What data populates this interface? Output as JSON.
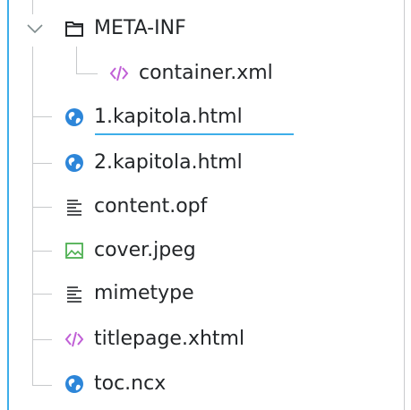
{
  "tree": {
    "items": [
      {
        "label": "META-INF",
        "icon": "folder-icon",
        "expanded": true
      },
      {
        "label": "container.xml",
        "icon": "xml-code-icon"
      },
      {
        "label": "1.kapitola.html",
        "icon": "globe-html-icon",
        "current": true
      },
      {
        "label": "2.kapitola.html",
        "icon": "globe-html-icon"
      },
      {
        "label": "content.opf",
        "icon": "text-file-icon"
      },
      {
        "label": "cover.jpeg",
        "icon": "image-file-icon"
      },
      {
        "label": "mimetype",
        "icon": "text-file-icon"
      },
      {
        "label": "titlepage.xhtml",
        "icon": "xml-code-icon"
      },
      {
        "label": "toc.ncx",
        "icon": "globe-html-icon"
      }
    ]
  },
  "colors": {
    "accent": "#3daee9",
    "guide": "#c7c9cb",
    "text": "#232629",
    "xml_icon": "#c05fd6",
    "globe_icon": "#2d86d9",
    "image_icon": "#4caf50"
  }
}
